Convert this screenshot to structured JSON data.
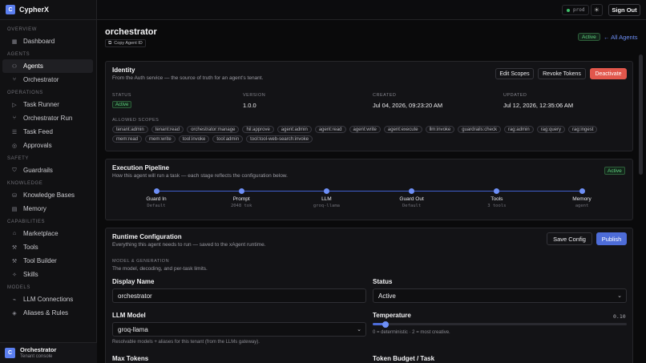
{
  "brand": {
    "logo_letter": "C",
    "name": "CypherX"
  },
  "sidebar": {
    "sections": [
      {
        "title": "OVERVIEW",
        "items": [
          {
            "label": "Dashboard",
            "icon": "grid-icon"
          }
        ]
      },
      {
        "title": "AGENTS",
        "items": [
          {
            "label": "Agents",
            "icon": "user-icon",
            "active": true
          },
          {
            "label": "Orchestrator",
            "icon": "branch-icon"
          }
        ]
      },
      {
        "title": "OPERATIONS",
        "items": [
          {
            "label": "Task Runner",
            "icon": "play-icon"
          },
          {
            "label": "Orchestrator Run",
            "icon": "branch-icon"
          },
          {
            "label": "Task Feed",
            "icon": "list-icon"
          },
          {
            "label": "Approvals",
            "icon": "check-circle-icon"
          }
        ]
      },
      {
        "title": "SAFETY",
        "items": [
          {
            "label": "Guardrails",
            "icon": "shield-icon"
          }
        ]
      },
      {
        "title": "KNOWLEDGE",
        "items": [
          {
            "label": "Knowledge Bases",
            "icon": "database-icon"
          },
          {
            "label": "Memory",
            "icon": "memory-icon"
          }
        ]
      },
      {
        "title": "CAPABILITIES",
        "items": [
          {
            "label": "Marketplace",
            "icon": "store-icon"
          },
          {
            "label": "Tools",
            "icon": "wrench-icon"
          },
          {
            "label": "Tool Builder",
            "icon": "hammer-icon"
          },
          {
            "label": "Skills",
            "icon": "sparkle-icon"
          }
        ]
      },
      {
        "title": "MODELS",
        "items": [
          {
            "label": "LLM Connections",
            "icon": "plug-icon"
          },
          {
            "label": "Aliases & Rules",
            "icon": "layers-icon"
          }
        ]
      }
    ],
    "footer": {
      "avatar_letter": "C",
      "title": "Orchestrator",
      "subtitle": "Tenant console"
    }
  },
  "topbar": {
    "env": "prod",
    "signout": "Sign Out"
  },
  "header": {
    "title": "orchestrator",
    "copy_label": "Copy Agent ID",
    "status": "Active",
    "back_link": "← All Agents"
  },
  "identity": {
    "title": "Identity",
    "subtitle": "From the Auth service — the source of truth for an agent's tenant.",
    "buttons": {
      "edit": "Edit Scopes",
      "revoke": "Revoke Tokens",
      "deactivate": "Deactivate"
    },
    "status_label": "STATUS",
    "status_value": "Active",
    "version_label": "VERSION",
    "version_value": "1.0.0",
    "created_label": "CREATED",
    "created_value": "Jul 04, 2026, 09:23:20 AM",
    "updated_label": "UPDATED",
    "updated_value": "Jul 12, 2026, 12:35:06 AM",
    "scopes_label": "ALLOWED SCOPES",
    "scopes": [
      "tenant:admin",
      "tenant:read",
      "orchestrator:manage",
      "hil:approve",
      "agent:admin",
      "agent:read",
      "agent:write",
      "agent:execute",
      "llm:invoke",
      "guardrails:check",
      "rag:admin",
      "rag:query",
      "rag:ingest",
      "mem:read",
      "mem:write",
      "tool:invoke",
      "tool:admin",
      "tool:tool-web-search:invoke"
    ]
  },
  "pipeline": {
    "title": "Execution Pipeline",
    "subtitle": "How this agent will run a task — each stage reflects the configuration below.",
    "status": "Active",
    "stages": [
      {
        "name": "Guard In",
        "sub": "Default"
      },
      {
        "name": "Prompt",
        "sub": "2048 tok"
      },
      {
        "name": "LLM",
        "sub": "groq-llama"
      },
      {
        "name": "Guard Out",
        "sub": "Default"
      },
      {
        "name": "Tools",
        "sub": "3 tools"
      },
      {
        "name": "Memory",
        "sub": "agent"
      }
    ]
  },
  "runtime": {
    "title": "Runtime Configuration",
    "subtitle": "Everything this agent needs to run — saved to the xAgent runtime.",
    "save": "Save Config",
    "publish": "Publish",
    "section_label": "MODEL & GENERATION",
    "section_sub": "The model, decoding, and per-task limits.",
    "display_name_label": "Display Name",
    "display_name_value": "orchestrator",
    "status_label": "Status",
    "status_value": "Active",
    "llm_label": "LLM Model",
    "llm_value": "groq-llama",
    "llm_hint": "Resolvable models + aliases for this tenant (from the LLMs gateway).",
    "temp_label": "Temperature",
    "temp_value": "0.10",
    "temp_fraction": 0.05,
    "temp_hint": "0 = deterministic · 2 = most creative.",
    "max_tokens_label": "Max Tokens",
    "budget_label": "Token Budget / Task"
  }
}
